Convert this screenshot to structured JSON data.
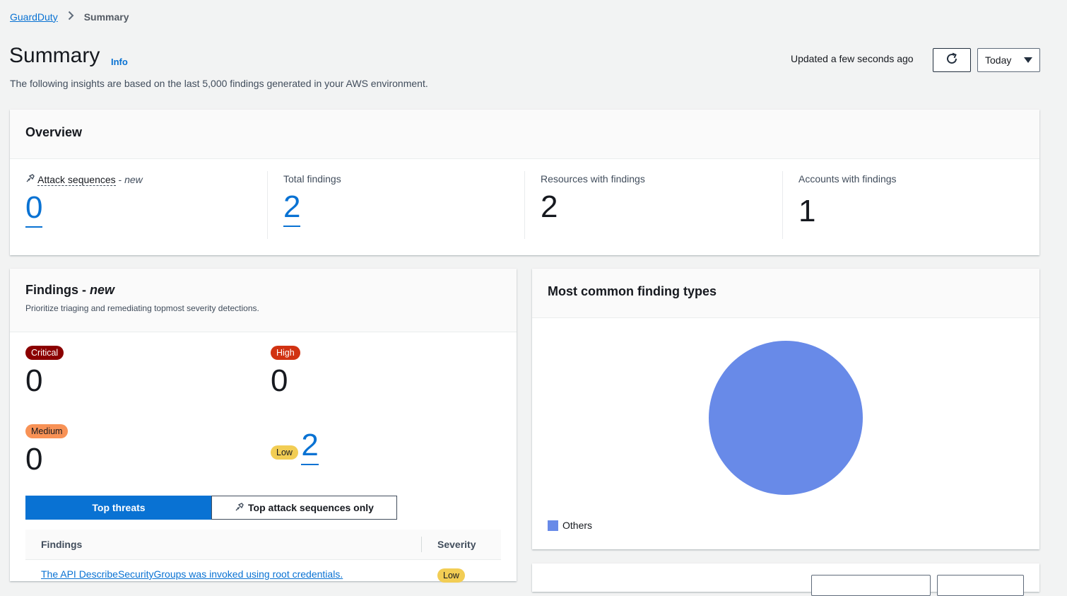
{
  "breadcrumb": {
    "root": "GuardDuty",
    "current": "Summary"
  },
  "header": {
    "title": "Summary",
    "info": "Info",
    "description": "The following insights are based on the last 5,000 findings generated in your AWS environment.",
    "updated": "Updated a few seconds ago",
    "date_range": "Today"
  },
  "overview": {
    "title": "Overview",
    "attack_sequences": {
      "label": "Attack sequences",
      "badge": "new",
      "value": "0"
    },
    "total_findings": {
      "label": "Total findings",
      "value": "2"
    },
    "resources": {
      "label": "Resources with findings",
      "value": "2"
    },
    "accounts": {
      "label": "Accounts with findings",
      "value": "1"
    }
  },
  "findings": {
    "title": "Findings",
    "title_badge": "new",
    "subtitle": "Prioritize triaging and remediating topmost severity detections.",
    "severities": [
      {
        "label": "Critical",
        "value": "0",
        "color": "#8b0000"
      },
      {
        "label": "High",
        "value": "0",
        "color": "#d13212"
      },
      {
        "label": "Medium",
        "value": "0",
        "color": "#f89256"
      },
      {
        "label": "Low",
        "value": "2",
        "color": "#f2cd54"
      }
    ],
    "tabs": {
      "top_threats": "Top threats",
      "top_attack": "Top attack sequences only"
    },
    "table": {
      "col_findings": "Findings",
      "col_severity": "Severity",
      "rows": [
        {
          "finding": "The API DescribeSecurityGroups was invoked using root credentials.",
          "severity": "Low"
        }
      ]
    }
  },
  "types": {
    "title": "Most common finding types",
    "legend": "Others",
    "chart_color": "#688ae8"
  },
  "chart_data": {
    "type": "pie",
    "categories": [
      "Others"
    ],
    "values": [
      2
    ],
    "title": "Most common finding types"
  }
}
